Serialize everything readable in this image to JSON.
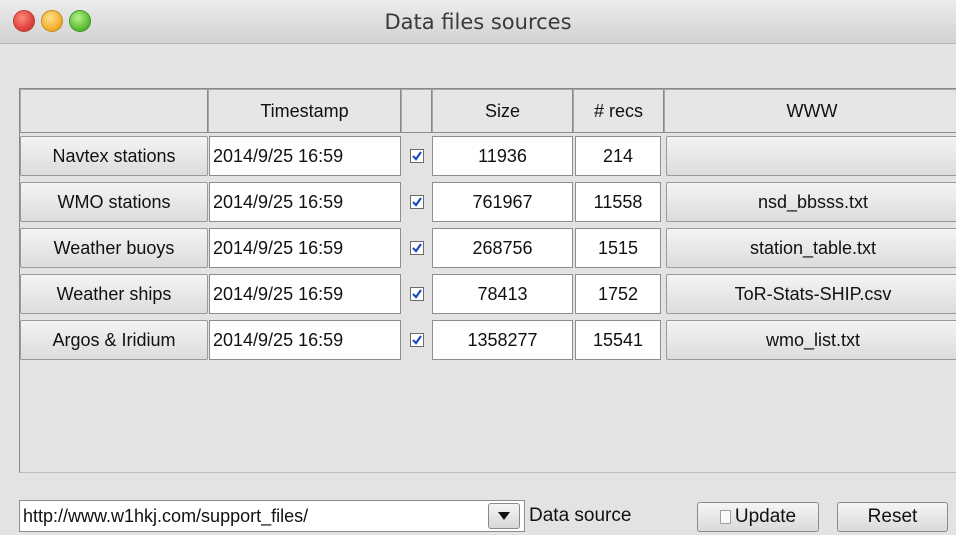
{
  "window": {
    "title": "Data files sources"
  },
  "table": {
    "headers": [
      "Timestamp",
      "",
      "Size",
      "# recs",
      "WWW"
    ],
    "rows": [
      {
        "name": "Navtex stations",
        "timestamp": "2014/9/25 16:59",
        "checked": true,
        "size": "11936",
        "recs": "214",
        "www": ""
      },
      {
        "name": "WMO stations",
        "timestamp": "2014/9/25 16:59",
        "checked": true,
        "size": "761967",
        "recs": "11558",
        "www": "nsd_bbsss.txt"
      },
      {
        "name": "Weather buoys",
        "timestamp": "2014/9/25 16:59",
        "checked": true,
        "size": "268756",
        "recs": "1515",
        "www": "station_table.txt"
      },
      {
        "name": "Weather ships",
        "timestamp": "2014/9/25 16:59",
        "checked": true,
        "size": "78413",
        "recs": "1752",
        "www": "ToR-Stats-SHIP.csv"
      },
      {
        "name": "Argos & Iridium",
        "timestamp": "2014/9/25 16:59",
        "checked": true,
        "size": "1358277",
        "recs": "15541",
        "www": "wmo_list.txt"
      }
    ]
  },
  "footer": {
    "url_value": "http://www.w1hkj.com/support_files/",
    "data_source_label": "Data source",
    "update_label": "Update",
    "update_checked": false,
    "reset_label": "Reset"
  }
}
